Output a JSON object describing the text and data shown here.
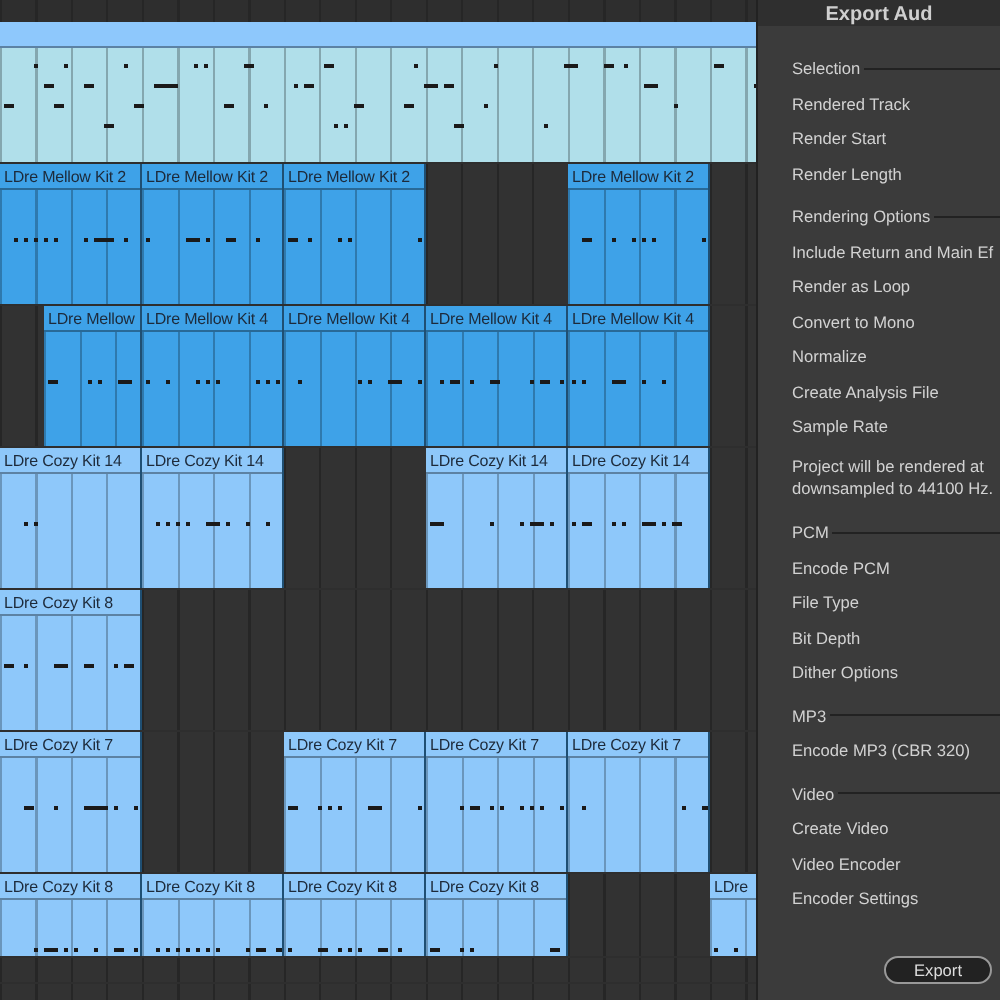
{
  "arrangement": {
    "tracks": [
      {
        "color": "#b0dfea",
        "bars": [
          {
            "kind": "full"
          }
        ]
      },
      {
        "color": "#3ea2e8",
        "bars": [
          {
            "kind": "clip",
            "title": "LDre Mellow Kit 2"
          },
          {
            "kind": "clip",
            "title": "LDre Mellow Kit 2"
          },
          {
            "kind": "clip",
            "title": "LDre Mellow Kit 2"
          },
          {
            "kind": "empty"
          },
          {
            "kind": "clip",
            "title": "LDre Mellow Kit 2"
          }
        ]
      },
      {
        "color": "#3ea2e8",
        "bars": [
          {
            "kind": "late_clip",
            "title": "LDre Mellow"
          },
          {
            "kind": "clip",
            "title": "LDre Mellow Kit 4"
          },
          {
            "kind": "clip",
            "title": "LDre Mellow Kit 4"
          },
          {
            "kind": "clip",
            "title": "LDre Mellow Kit 4"
          },
          {
            "kind": "clip",
            "title": "LDre Mellow Kit 4"
          }
        ]
      },
      {
        "color": "#8ec8fa",
        "bars": [
          {
            "kind": "clip",
            "title": "LDre Cozy Kit 14"
          },
          {
            "kind": "clip",
            "title": "LDre Cozy Kit 14"
          },
          {
            "kind": "empty"
          },
          {
            "kind": "clip",
            "title": "LDre Cozy Kit 14"
          },
          {
            "kind": "clip",
            "title": "LDre Cozy Kit 14"
          }
        ]
      },
      {
        "color": "#8ec8fa",
        "bars": [
          {
            "kind": "clip",
            "title": "LDre Cozy Kit 8"
          }
        ]
      },
      {
        "color": "#8ec8fa",
        "bars": [
          {
            "kind": "clip",
            "title": "LDre Cozy Kit 7"
          },
          {
            "kind": "empty"
          },
          {
            "kind": "clip",
            "title": "LDre Cozy Kit 7"
          },
          {
            "kind": "clip",
            "title": "LDre Cozy Kit 7"
          },
          {
            "kind": "clip",
            "title": "LDre Cozy Kit 7"
          }
        ]
      },
      {
        "color": "#8ec8fa",
        "bars": [
          {
            "kind": "clip",
            "title": "LDre Cozy Kit 8"
          },
          {
            "kind": "clip",
            "title": "LDre Cozy Kit 8"
          },
          {
            "kind": "clip",
            "title": "LDre Cozy Kit 8"
          },
          {
            "kind": "clip",
            "title": "LDre Cozy Kit 8"
          },
          {
            "kind": "empty"
          },
          {
            "kind": "clip",
            "title": "LDre"
          }
        ]
      }
    ]
  },
  "export_panel": {
    "title": "Export Aud",
    "items": [
      {
        "kind": "section",
        "label": "Selection"
      },
      {
        "kind": "option",
        "label": "Rendered Track"
      },
      {
        "kind": "option",
        "label": "Render Start"
      },
      {
        "kind": "option",
        "label": "Render Length"
      },
      {
        "kind": "section",
        "label": "Rendering Options"
      },
      {
        "kind": "option",
        "label": "Include Return and Main Ef"
      },
      {
        "kind": "option",
        "label": "Render as Loop"
      },
      {
        "kind": "option",
        "label": "Convert to Mono"
      },
      {
        "kind": "option",
        "label": "Normalize"
      },
      {
        "kind": "option",
        "label": "Create Analysis File"
      },
      {
        "kind": "option",
        "label": "Sample Rate"
      },
      {
        "kind": "note",
        "label": "Project will be rendered at\ndownsampled to 44100 Hz."
      },
      {
        "kind": "section",
        "label": "PCM"
      },
      {
        "kind": "option",
        "label": "Encode PCM"
      },
      {
        "kind": "option",
        "label": "File Type"
      },
      {
        "kind": "option",
        "label": "Bit Depth"
      },
      {
        "kind": "option",
        "label": "Dither Options"
      },
      {
        "kind": "section",
        "label": "MP3"
      },
      {
        "kind": "option",
        "label": "Encode MP3 (CBR 320)"
      },
      {
        "kind": "section",
        "label": "Video"
      },
      {
        "kind": "option",
        "label": "Create Video"
      },
      {
        "kind": "option",
        "label": "Video Encoder"
      },
      {
        "kind": "option",
        "label": "Encoder Settings"
      }
    ],
    "button": "Export"
  }
}
